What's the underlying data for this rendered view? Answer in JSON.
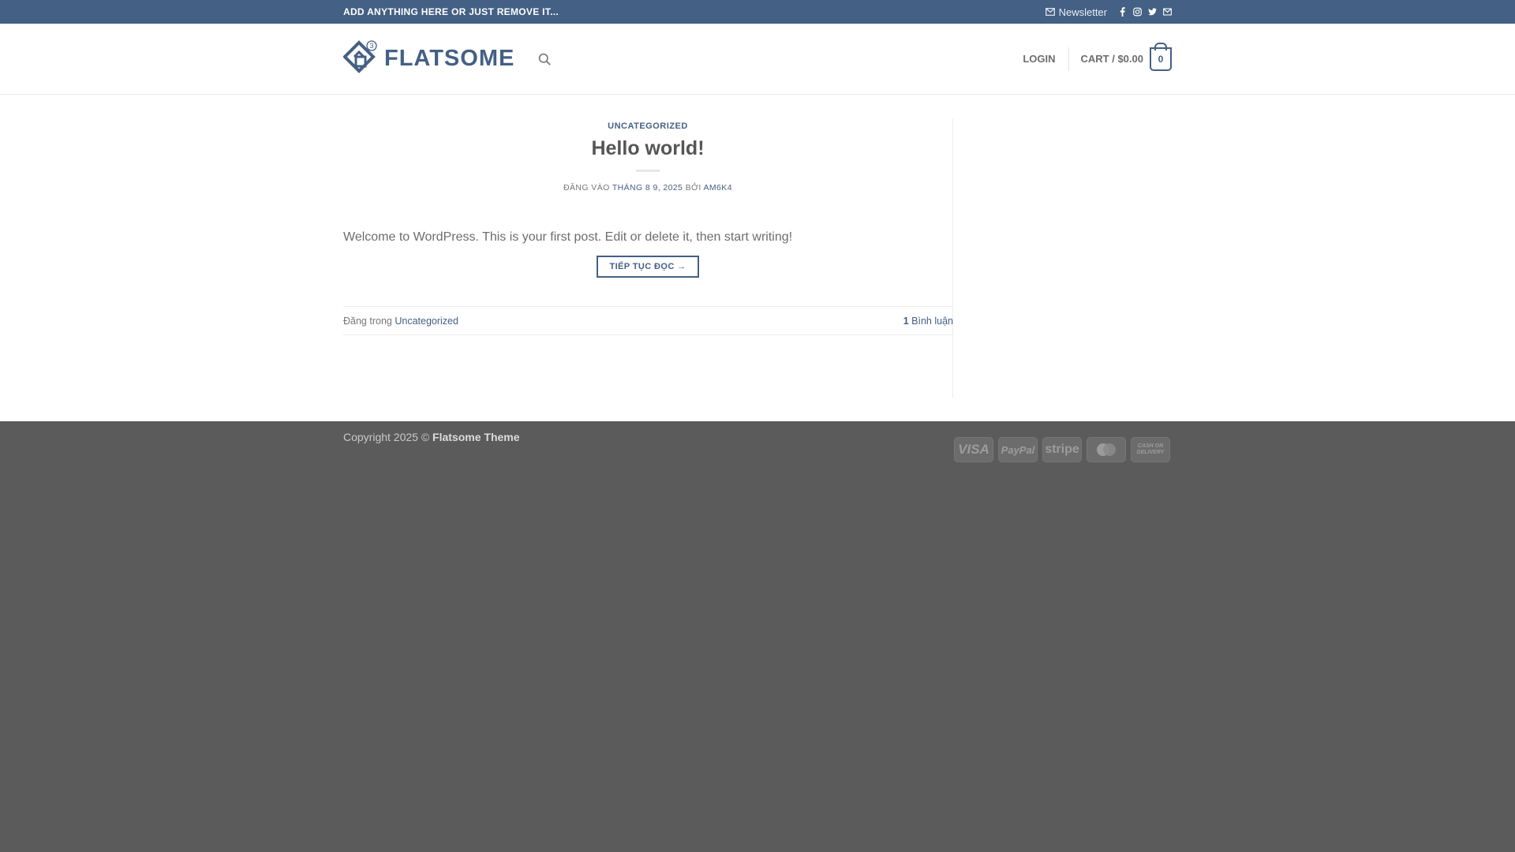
{
  "topbar": {
    "text": "ADD ANYTHING HERE OR JUST REMOVE IT...",
    "newsletter_label": "Newsletter",
    "social_icons": [
      "facebook-icon",
      "instagram-icon",
      "twitter-icon",
      "email-icon"
    ]
  },
  "header": {
    "logo_text": "FLATSOME",
    "logo_badge": "3",
    "login_label": "LOGIN",
    "cart_label": "CART / $0.00",
    "cart_count": "0"
  },
  "post": {
    "category": "UNCATEGORIZED",
    "title": "Hello world!",
    "meta_prefix": "ĐĂNG VÀO",
    "meta_date": "THÁNG 8 9, 2025",
    "meta_by": "BỞI",
    "meta_author": "AM6K4",
    "excerpt": "Welcome to WordPress. This is your first post. Edit or delete it, then start writing!",
    "read_more": "TIẾP TỤC ĐỌC →",
    "footer_prefix": "Đăng trong",
    "footer_category": "Uncategorized",
    "comments_count": "1",
    "comments_label": "Bình luận"
  },
  "footer": {
    "copyright_prefix": "Copyright 2025 ©",
    "copyright_brand": "Flatsome Theme",
    "payments": {
      "visa": "VISA",
      "paypal": "PayPal",
      "stripe": "stripe",
      "cash_line1": "CASH ON",
      "cash_line2": "DELIVERY"
    }
  },
  "colors": {
    "primary": "#446084",
    "footer_bg": "#5b5b5b"
  }
}
